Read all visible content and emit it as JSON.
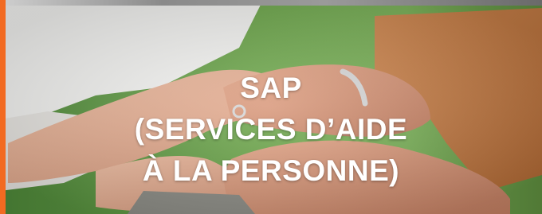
{
  "banner": {
    "title_lines": [
      "SAP",
      "(SERVICES D’AIDE",
      "À LA PERSONNE)"
    ],
    "accent_color": "#f26a21",
    "background": "photo-of-caring-hands"
  }
}
